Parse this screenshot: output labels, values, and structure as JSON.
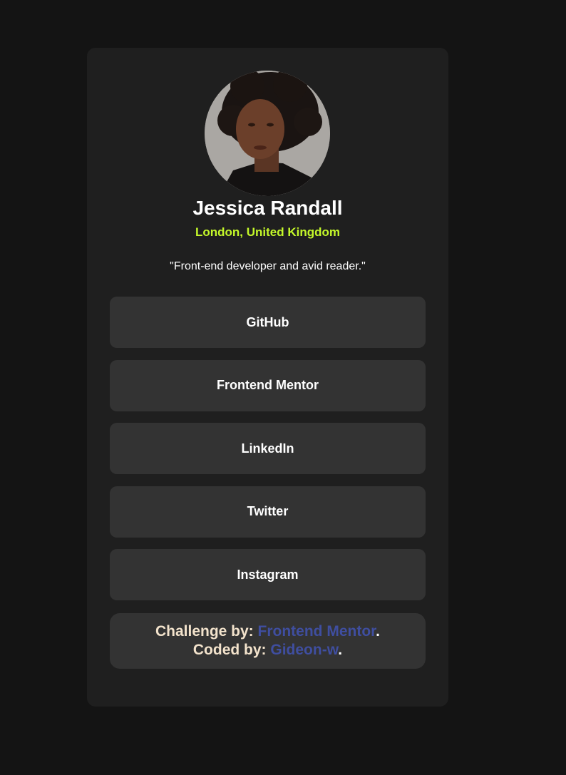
{
  "profile": {
    "name": "Jessica Randall",
    "location": "London, United Kingdom",
    "bio": "\"Front-end developer and avid reader.\""
  },
  "links": [
    {
      "label": "GitHub"
    },
    {
      "label": "Frontend Mentor"
    },
    {
      "label": "LinkedIn"
    },
    {
      "label": "Twitter"
    },
    {
      "label": "Instagram"
    }
  ],
  "attribution": {
    "challenge_prefix": "Challenge by: ",
    "challenge_link": "Frontend Mentor",
    "coded_prefix": "Coded by: ",
    "coded_link": "Gideon-w",
    "period": "."
  },
  "colors": {
    "page_bg": "#141414",
    "card_bg": "#1f1f1f",
    "button_bg": "#333333",
    "accent_green": "#c4f82a",
    "link_blue": "#3f4ea0",
    "attribution_text": "#f3e3cc"
  }
}
